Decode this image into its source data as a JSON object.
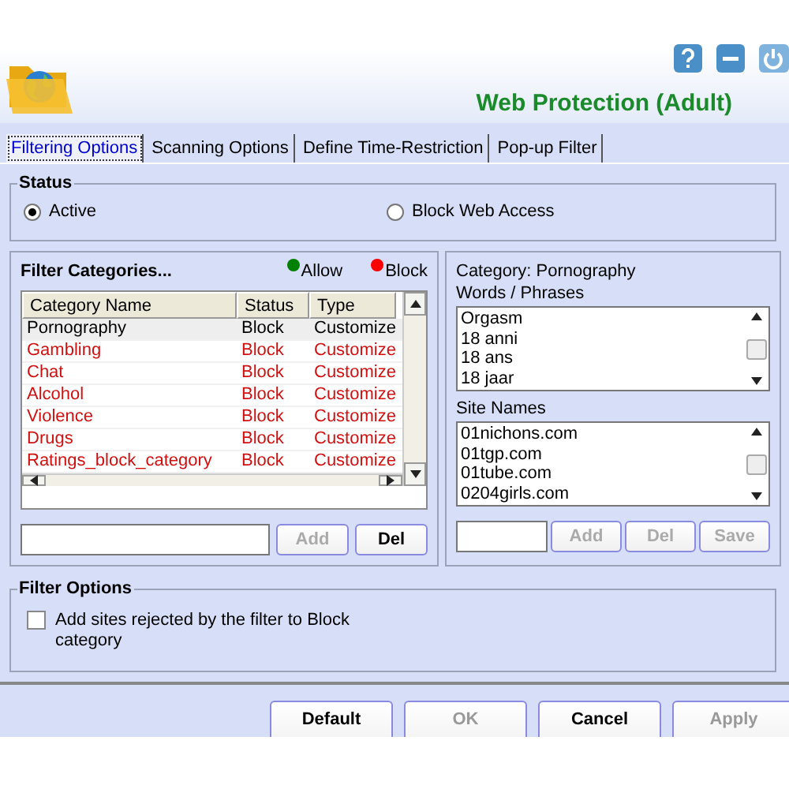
{
  "header": {
    "title": "Web Protection (Adult)"
  },
  "tabs": [
    {
      "label": "Filtering Options",
      "selected": true
    },
    {
      "label": "Scanning Options",
      "selected": false
    },
    {
      "label": "Define Time-Restriction",
      "selected": false
    },
    {
      "label": "Pop-up Filter",
      "selected": false
    }
  ],
  "status": {
    "title": "Status",
    "options": [
      {
        "label": "Active",
        "selected": true
      },
      {
        "label": "Block Web Access",
        "selected": false
      }
    ]
  },
  "filter_categories": {
    "title": "Filter Categories...",
    "legend": [
      {
        "label": "Allow",
        "color": "#008000"
      },
      {
        "label": "Block",
        "color": "#ff0000"
      }
    ],
    "columns": [
      "Category Name",
      "Status",
      "Type"
    ],
    "rows": [
      {
        "cells": [
          "Pornography",
          "Block",
          "Customize"
        ],
        "selected": true,
        "blocked": true
      },
      {
        "cells": [
          "Gambling",
          "Block",
          "Customize"
        ],
        "selected": false,
        "blocked": true
      },
      {
        "cells": [
          "Chat",
          "Block",
          "Customize"
        ],
        "selected": false,
        "blocked": true
      },
      {
        "cells": [
          "Alcohol",
          "Block",
          "Customize"
        ],
        "selected": false,
        "blocked": true
      },
      {
        "cells": [
          "Violence",
          "Block",
          "Customize"
        ],
        "selected": false,
        "blocked": true
      },
      {
        "cells": [
          "Drugs",
          "Block",
          "Customize"
        ],
        "selected": false,
        "blocked": true
      },
      {
        "cells": [
          "Ratings_block_category",
          "Block",
          "Customize"
        ],
        "selected": false,
        "blocked": true
      }
    ],
    "buttons": [
      {
        "label": "Add",
        "disabled": true
      },
      {
        "label": "Del",
        "disabled": false
      }
    ]
  },
  "category_detail": {
    "category": "Category: Pornography",
    "words_label": "Words / Phrases",
    "words": [
      "Orgasm",
      "18 anni",
      "18 ans",
      "18 jaar"
    ],
    "sites_label": "Site Names",
    "sites": [
      "01nichons.com",
      "01tgp.com",
      "01tube.com",
      "0204girls.com"
    ],
    "buttons": [
      {
        "label": "Add",
        "disabled": true
      },
      {
        "label": "Del",
        "disabled": true
      },
      {
        "label": "Save",
        "disabled": true
      }
    ]
  },
  "filter_options": {
    "title": "Filter Options",
    "checkbox": {
      "label": "Add sites rejected by the filter to Block category",
      "checked": false
    }
  },
  "footer_buttons": [
    {
      "label": "Default",
      "disabled": false
    },
    {
      "label": "OK",
      "disabled": true
    },
    {
      "label": "Cancel",
      "disabled": false
    },
    {
      "label": "Apply",
      "disabled": true
    }
  ]
}
